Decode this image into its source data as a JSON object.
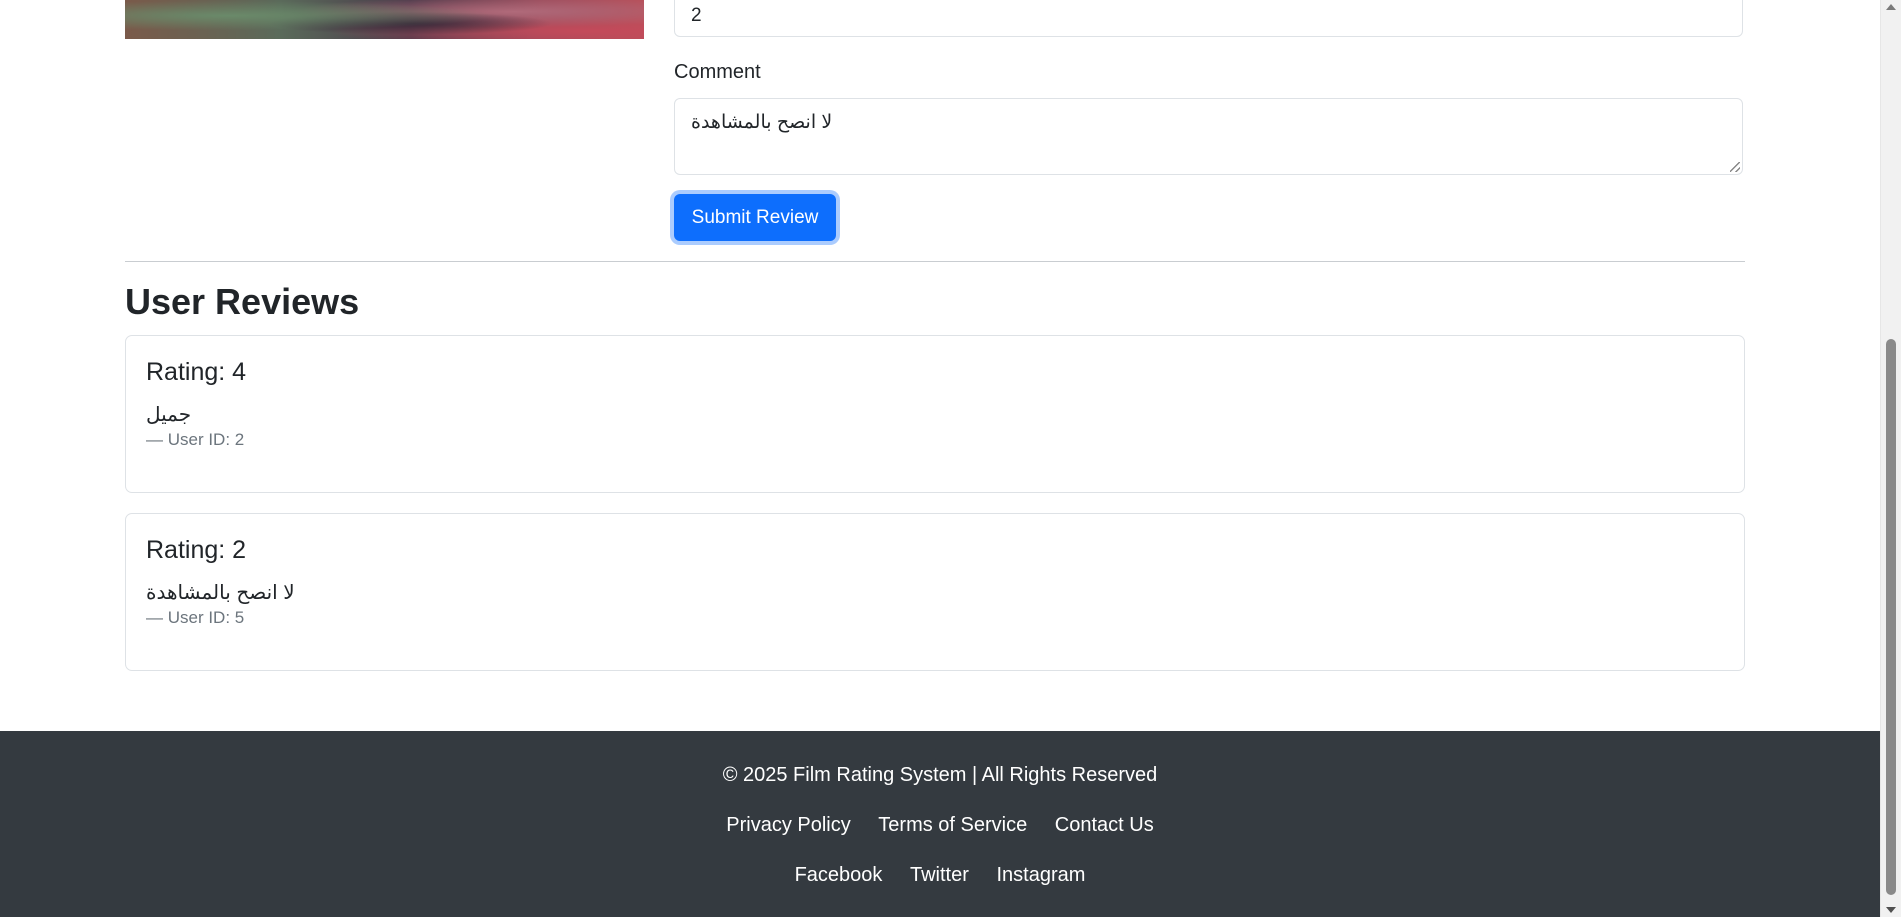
{
  "review_form": {
    "rating_value": "2",
    "comment_label": "Comment",
    "comment_value": "لا انصح بالمشاهدة",
    "submit_label": "Submit Review"
  },
  "reviews_section": {
    "title": "User Reviews",
    "reviews": [
      {
        "rating": "Rating: 4",
        "comment": "جميل",
        "user": "— User ID: 2"
      },
      {
        "rating": "Rating: 2",
        "comment": "لا انصح بالمشاهدة",
        "user": "— User ID: 5"
      }
    ]
  },
  "footer": {
    "copyright": "© 2025 Film Rating System | All Rights Reserved",
    "links": [
      "Privacy Policy",
      "Terms of Service",
      "Contact Us"
    ],
    "social": [
      "Facebook",
      "Twitter",
      "Instagram"
    ]
  },
  "colors": {
    "primary": "#0d6efd",
    "footer_bg": "#343a40",
    "muted": "#6c757d"
  }
}
